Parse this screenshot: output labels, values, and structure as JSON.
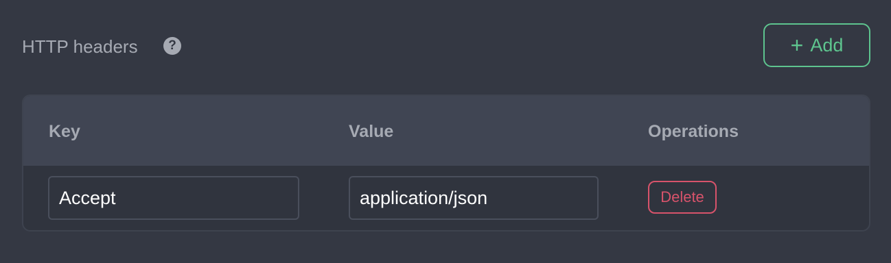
{
  "section": {
    "title": "HTTP headers",
    "help_icon": "question-circle-icon",
    "add_label": "Add",
    "add_icon": "plus-icon"
  },
  "table": {
    "columns": [
      "Key",
      "Value",
      "Operations"
    ],
    "rows": [
      {
        "key": "Accept",
        "value": "application/json",
        "action": "Delete"
      }
    ]
  },
  "colors": {
    "background": "#343843",
    "header_bg": "#404553",
    "accent_green": "#5ec58f",
    "danger_red": "#d8536b",
    "muted_text": "#a6aab3"
  }
}
